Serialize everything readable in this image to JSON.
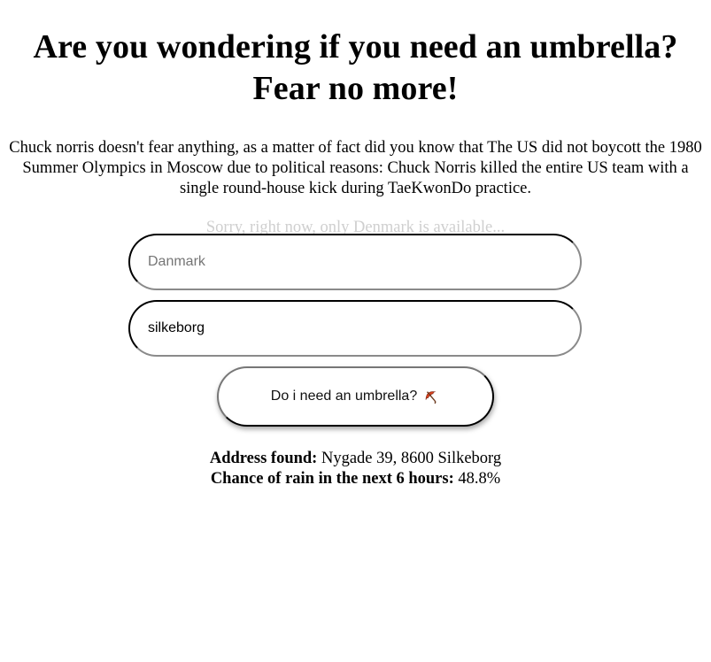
{
  "header": {
    "title_line1": "Are you wondering if you need an umbrella?",
    "title_line2": "Fear no more!"
  },
  "intro": {
    "text": "Chuck norris doesn't fear anything, as a matter of fact did you know that The US did not boycott the 1980 Summer Olympics in Moscow due to political reasons: Chuck Norris killed the entire US team with a single round-house kick during TaeKwonDo practice."
  },
  "notice": {
    "text": "Sorry, right now, only Denmark is available..."
  },
  "form": {
    "country": {
      "value": "",
      "placeholder": "Danmark"
    },
    "city": {
      "value": "silkeborg",
      "placeholder": ""
    },
    "submit_label": "Do i need an umbrella?",
    "submit_icon": "umbrella-icon"
  },
  "results": {
    "address_label": "Address found:",
    "address_value": "Nygade 39, 8600 Silkeborg",
    "rain_label": "Chance of rain in the next 6 hours:",
    "rain_value": "48.8%"
  },
  "colors": {
    "notice_text": "#cfcfcf",
    "umbrella_canopy": "#d9411e",
    "umbrella_handle": "#6b3a1f"
  }
}
